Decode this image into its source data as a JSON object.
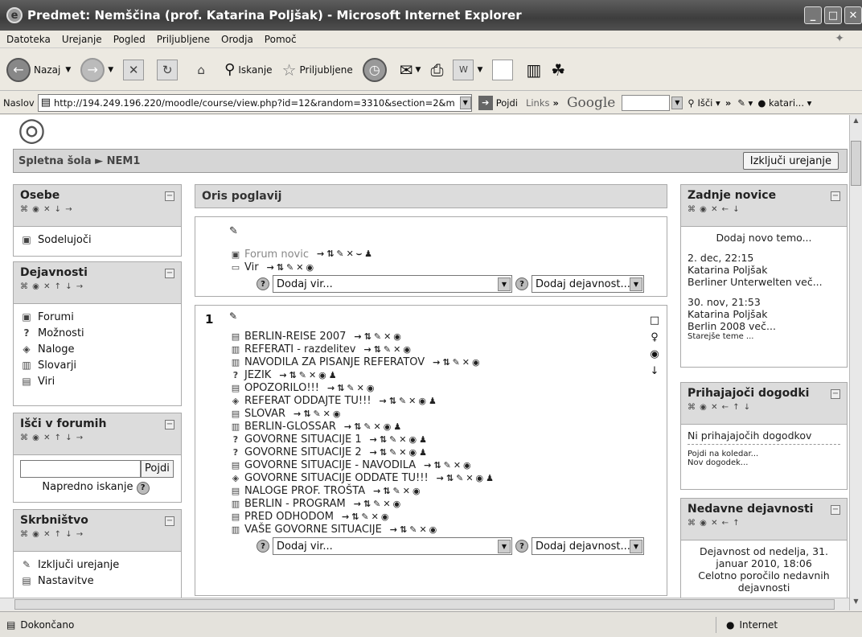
{
  "window": {
    "title": "Predmet: Nemščina (prof. Katarina Poljšak) - Microsoft Internet Explorer"
  },
  "menu": [
    "Datoteka",
    "Urejanje",
    "Pogled",
    "Priljubljene",
    "Orodja",
    "Pomoč"
  ],
  "toolbar": {
    "back": "Nazaj",
    "search": "Iskanje",
    "favorites": "Priljubljene"
  },
  "address": {
    "label": "Naslov",
    "url": "http://194.249.196.220/moodle/course/view.php?id=12&random=3310&section=2&m",
    "go": "Pojdi",
    "links": "Links",
    "google": "Google",
    "isci": "Išči",
    "user": "katari..."
  },
  "crumb": {
    "path": "Spletna šola ► NEM1",
    "button": "Izključi urejanje"
  },
  "left": {
    "osebe": {
      "title": "Osebe",
      "icons": "⌘ ◉ ✕ ↓ →",
      "items": [
        "Sodelujoči"
      ]
    },
    "dejavnosti": {
      "title": "Dejavnosti",
      "icons": "⌘ ◉ ✕ ↑ ↓ →",
      "items": [
        "Forumi",
        "Možnosti",
        "Naloge",
        "Slovarji",
        "Viri"
      ]
    },
    "isci": {
      "title": "Išči v forumih",
      "icons": "⌘ ◉ ✕ ↑ ↓ →",
      "button": "Pojdi",
      "advanced": "Napredno iskanje"
    },
    "skrbnistvo": {
      "title": "Skrbništvo",
      "icons": "⌘ ◉ ✕ ↑ ↓ →",
      "items": [
        "Izključi urejanje",
        "Nastavitve"
      ]
    }
  },
  "center": {
    "header": "Oris poglavij",
    "sec0": {
      "items": [
        "Forum novic",
        "Vir"
      ],
      "addres": "Dodaj vir...",
      "addact": "Dodaj dejavnost..."
    },
    "sec1": {
      "num": "1",
      "items": [
        "BERLIN-REISE 2007",
        "REFERATI - razdelitev",
        "NAVODILA ZA PISANJE REFERATOV",
        "JEZIK",
        "OPOZORILO!!!",
        "REFERAT ODDAJTE TU!!!",
        "SLOVAR",
        "BERLIN-GLOSSAR",
        "GOVORNE SITUACIJE 1",
        "GOVORNE SITUACIJE 2",
        "GOVORNE SITUACIJE - NAVODILA",
        "GOVORNE SITUACIJE ODDATE TU!!!",
        "NALOGE PROF. TROŠTA",
        "BERLIN - PROGRAM",
        "PRED ODHODOM",
        "VAŠE GOVORNE SITUACIJE"
      ],
      "addres": "Dodaj vir...",
      "addact": "Dodaj dejavnost..."
    }
  },
  "right": {
    "novice": {
      "title": "Zadnje novice",
      "icons": "⌘ ◉ ✕ ← ↓",
      "add": "Dodaj novo temo...",
      "n1": [
        "2. dec, 22:15",
        "Katarina Poljšak",
        "Berliner Unterwelten več..."
      ],
      "n2": [
        "30. nov, 21:53",
        "Katarina Poljšak",
        "Berlin 2008 več..."
      ],
      "older": "Starejše teme ..."
    },
    "dogodki": {
      "title": "Prihajajoči dogodki",
      "icons": "⌘ ◉ ✕ ← ↑ ↓",
      "none": "Ni prihajajočih dogodkov",
      "cal": "Pojdi na koledar...",
      "new": "Nov dogodek..."
    },
    "dejavnosti": {
      "title": "Nedavne dejavnosti",
      "icons": "⌘ ◉ ✕ ← ↑",
      "text": "Dejavnost od nedelja, 31. januar 2010, 18:06",
      "report": "Celotno poročilo nedavnih dejavnosti"
    }
  },
  "status": {
    "text": "Dokončano",
    "zone": "Internet"
  }
}
